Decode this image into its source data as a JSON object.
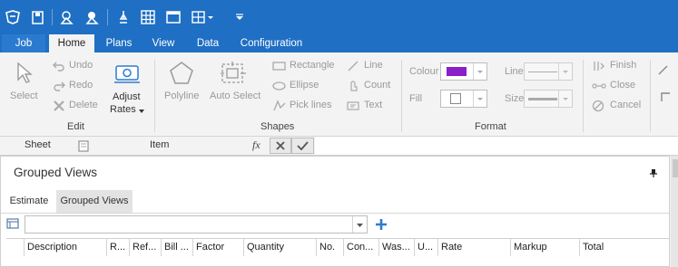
{
  "colors": {
    "titlebar": "#1f6fc4",
    "accent": "#2f7bd1",
    "fill_colour_swatch": "#8a1fc8"
  },
  "quick_access": {
    "icons": [
      "app-logo-icon",
      "save-icon",
      "shapes-icon",
      "toggle-shapes-icon",
      "measure-icon",
      "grid-icon",
      "window-icon",
      "table-dropdown-icon",
      "customize-icon"
    ]
  },
  "tabs": [
    {
      "label": "Job",
      "active": false
    },
    {
      "label": "Home",
      "active": true
    },
    {
      "label": "Plans",
      "active": false
    },
    {
      "label": "View",
      "active": false
    },
    {
      "label": "Data",
      "active": false
    },
    {
      "label": "Configuration",
      "active": false
    }
  ],
  "ribbon": {
    "select": "Select",
    "undo": "Undo",
    "redo": "Redo",
    "delete": "Delete",
    "adjust_rates_1": "Adjust",
    "adjust_rates_2": "Rates",
    "edit_group": "Edit",
    "polyline": "Polyline",
    "auto_select": "Auto Select",
    "rectangle": "Rectangle",
    "ellipse": "Ellipse",
    "pick_lines": "Pick lines",
    "line": "Line",
    "count": "Count",
    "text": "Text",
    "shapes_group": "Shapes",
    "colour": "Colour",
    "fill": "Fill",
    "line_style": "Line",
    "size": "Size",
    "format_group": "Format",
    "finish": "Finish",
    "close": "Close",
    "cancel": "Cancel"
  },
  "formula_bar": {
    "sheet_label": "Sheet",
    "item_label": "Item",
    "fx": "fx"
  },
  "panel": {
    "title": "Grouped Views",
    "subtabs": [
      {
        "label": "Estimate",
        "active": false
      },
      {
        "label": "Grouped Views",
        "active": true
      }
    ],
    "view_select_value": "",
    "columns": [
      "Description",
      "R...",
      "Ref...",
      "Bill ...",
      "Factor",
      "Quantity",
      "No.",
      "Con...",
      "Was...",
      "U...",
      "Rate",
      "Markup",
      "Total"
    ]
  }
}
